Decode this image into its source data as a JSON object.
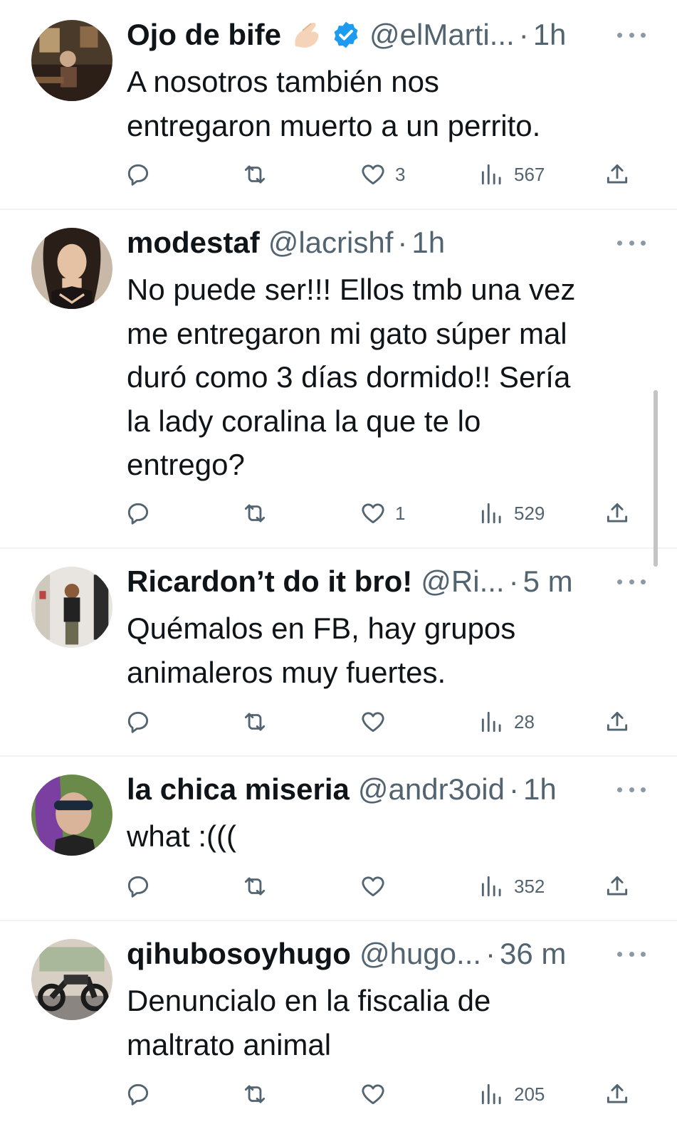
{
  "icons": {
    "reply": "reply-icon",
    "retweet": "retweet-icon",
    "like": "heart-icon",
    "views": "views-icon",
    "share": "share-icon",
    "more": "more-icon",
    "verified": "verified-badge-icon",
    "emoji": "pinching-hand-emoji-icon"
  },
  "colors": {
    "verified": "#1d9bf0",
    "muted": "#536471",
    "divider": "#eff3f4"
  },
  "tweets": [
    {
      "name": "Ojo de bife",
      "handle": "@elMarti...",
      "time": "1h",
      "lines": [
        "A nosotros también nos",
        "entregaron muerto a un perrito."
      ],
      "likes": "3",
      "views": "567"
    },
    {
      "name": "modestaf",
      "handle": "@lacrishf",
      "time": "1h",
      "lines": [
        "No puede ser!!! Ellos tmb una vez",
        "me entregaron mi gato súper mal",
        "duró como 3 días dormido!! Sería",
        "la lady coralina la que te lo",
        "entrego?"
      ],
      "likes": "1",
      "views": "529"
    },
    {
      "name": "Ricardon’t do it bro!",
      "handle": "@Ri...",
      "time": "5 m",
      "lines": [
        "Quémalos en FB, hay grupos",
        "animaleros muy fuertes."
      ],
      "likes": "",
      "views": "28"
    },
    {
      "name": "la chica miseria",
      "handle": "@andr3oid",
      "time": "1h",
      "lines": [
        "what :((("
      ],
      "likes": "",
      "views": "352"
    },
    {
      "name": "qihubosoyhugo",
      "handle": "@hugo...",
      "time": "36 m",
      "lines": [
        "Denuncialo en la fiscalia de",
        "maltrato animal"
      ],
      "likes": "",
      "views": "205"
    }
  ]
}
